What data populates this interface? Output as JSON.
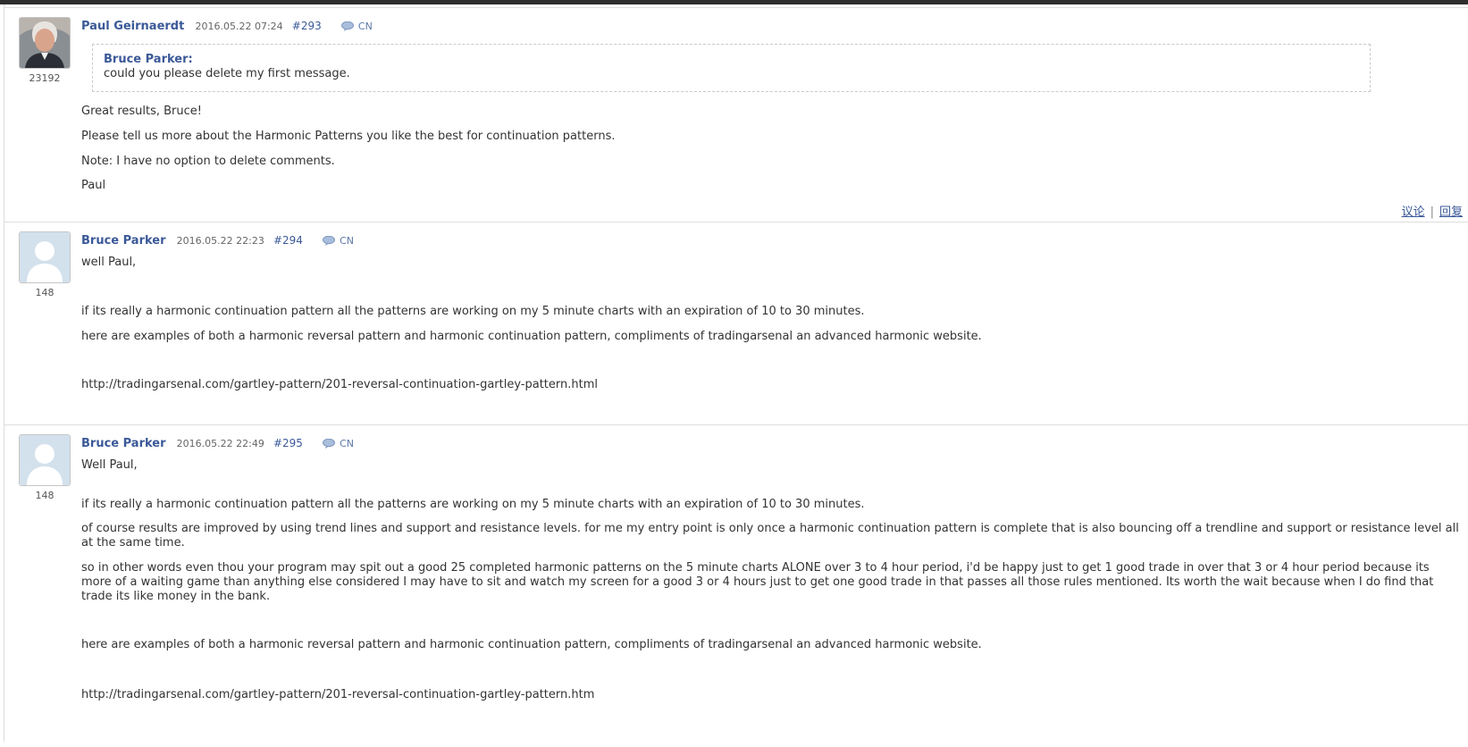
{
  "comments": [
    {
      "author": "Paul Geirnaerdt",
      "avatar_count": "23192",
      "date": "2016.05.22 07:24",
      "number": "#293",
      "lang": "CN",
      "quote": {
        "author": "Bruce Parker:",
        "text": "could you please delete my first message."
      },
      "paragraphs": [
        "Great results, Bruce!",
        "Please tell us more about the Harmonic Patterns you like the best for continuation patterns.",
        "Note: I have no option to delete comments.",
        "Paul"
      ],
      "actions": {
        "discuss": "议论",
        "separator": "|",
        "reply": "回复"
      }
    },
    {
      "author": "Bruce Parker",
      "avatar_count": "148",
      "date": "2016.05.22 22:23",
      "number": "#294",
      "lang": "CN",
      "paragraphs": [
        "well Paul,",
        "if its really a harmonic continuation pattern all the patterns are working on my 5 minute charts with an expiration of 10 to 30 minutes.",
        "here are examples of both a harmonic reversal pattern and harmonic continuation pattern, compliments of tradingarsenal an advanced harmonic website.",
        "http://tradingarsenal.com/gartley-pattern/201-reversal-continuation-gartley-pattern.html"
      ]
    },
    {
      "author": "Bruce Parker",
      "avatar_count": "148",
      "date": "2016.05.22 22:49",
      "number": "#295",
      "lang": "CN",
      "paragraphs": [
        "Well Paul,",
        "if its really a harmonic continuation pattern all the patterns are working on my 5 minute charts with an expiration of 10 to 30 minutes.",
        "of course results are improved by using trend lines and support and resistance levels. for me my entry point is only once a harmonic continuation pattern is complete that is also bouncing off a trendline and support or resistance level all at the same time.",
        "so in other words even thou your program may spit out a good 25 completed harmonic patterns on the 5 minute charts ALONE over 3 to 4 hour period, i'd be happy just to get 1 good trade in over that 3 or 4 hour period because its more of a waiting game than anything else considered I may have to sit and watch my screen for a good 3 or 4 hours just to get one good trade in that passes all those rules mentioned.  Its worth the wait because when I do find that trade its like money in the bank.",
        "here are examples of both a harmonic reversal pattern and harmonic continuation pattern, compliments of tradingarsenal an advanced harmonic website.",
        "http://tradingarsenal.com/gartley-pattern/201-reversal-continuation-gartley-pattern.htm"
      ]
    }
  ]
}
